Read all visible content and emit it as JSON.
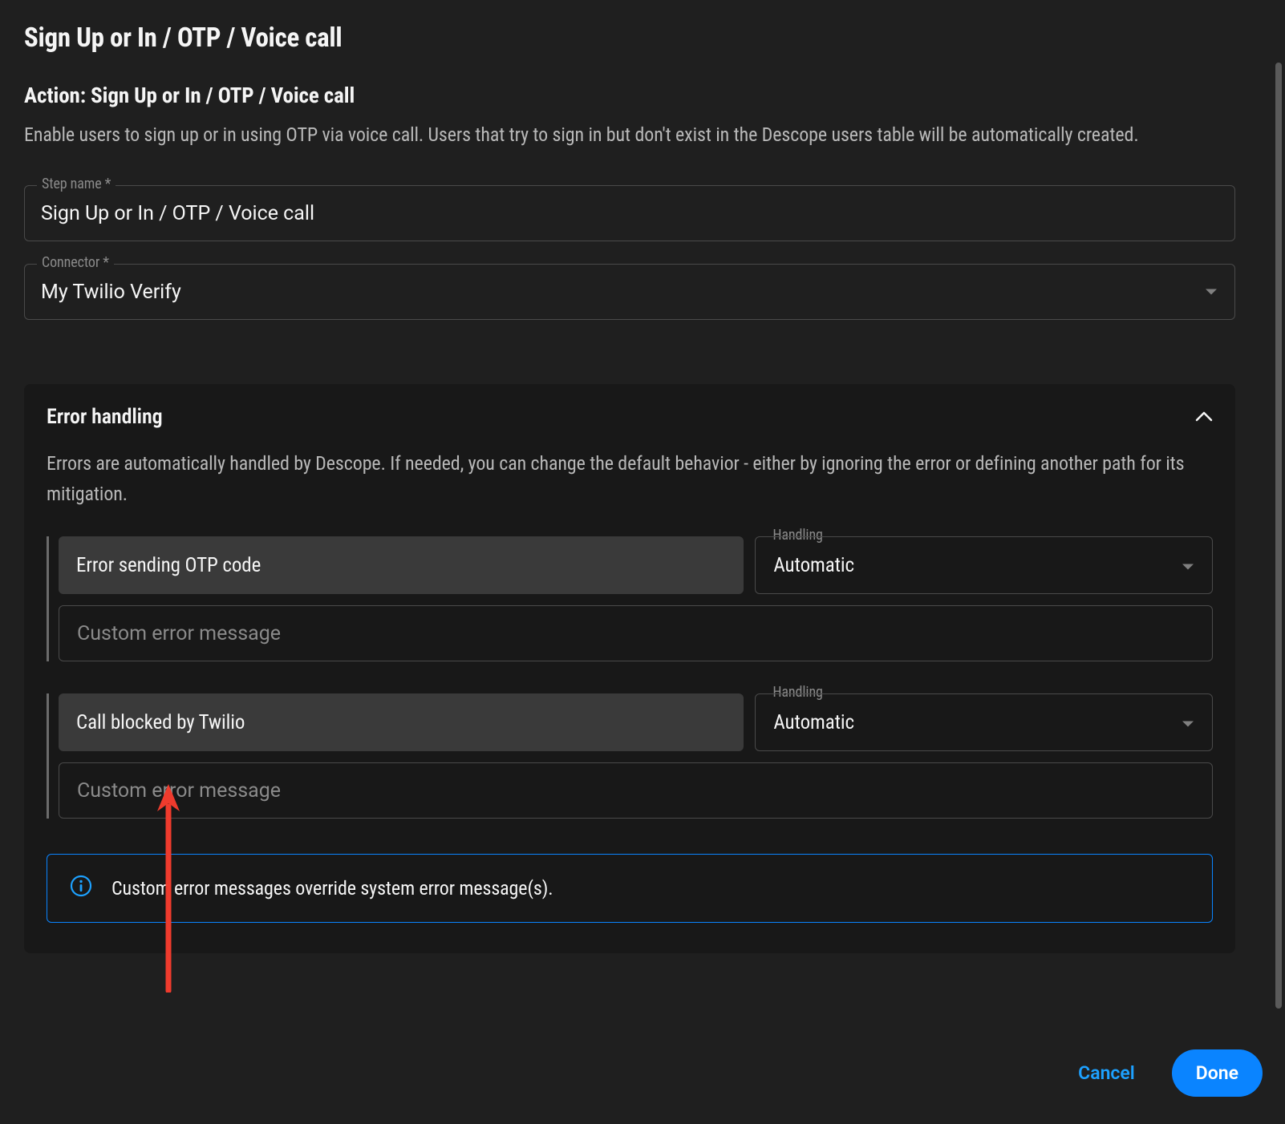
{
  "page": {
    "title": "Sign Up or In / OTP / Voice call",
    "action_title": "Action:  Sign Up or In / OTP / Voice call",
    "description": "Enable users to sign up or in using OTP via voice call. Users that try to sign in but don't exist in the Descope users table will be automatically created."
  },
  "fields": {
    "step_name": {
      "label": "Step name *",
      "value": "Sign Up or In / OTP / Voice call"
    },
    "connector": {
      "label": "Connector *",
      "value": "My Twilio Verify"
    }
  },
  "error_handling": {
    "title": "Error handling",
    "description": "Errors are automatically handled by Descope. If needed, you can change the default behavior - either by ignoring the error or defining another path for its mitigation.",
    "handling_label": "Handling",
    "custom_placeholder": "Custom error message",
    "errors": [
      {
        "name": "Error sending OTP code",
        "handling": "Automatic",
        "custom_message": ""
      },
      {
        "name": "Call blocked by Twilio",
        "handling": "Automatic",
        "custom_message": ""
      }
    ],
    "info": "Custom error messages override system error message(s)."
  },
  "buttons": {
    "cancel": "Cancel",
    "done": "Done"
  },
  "colors": {
    "accent": "#1da1ff",
    "done": "#0a84ff",
    "arrow": "#ef3b2d"
  }
}
